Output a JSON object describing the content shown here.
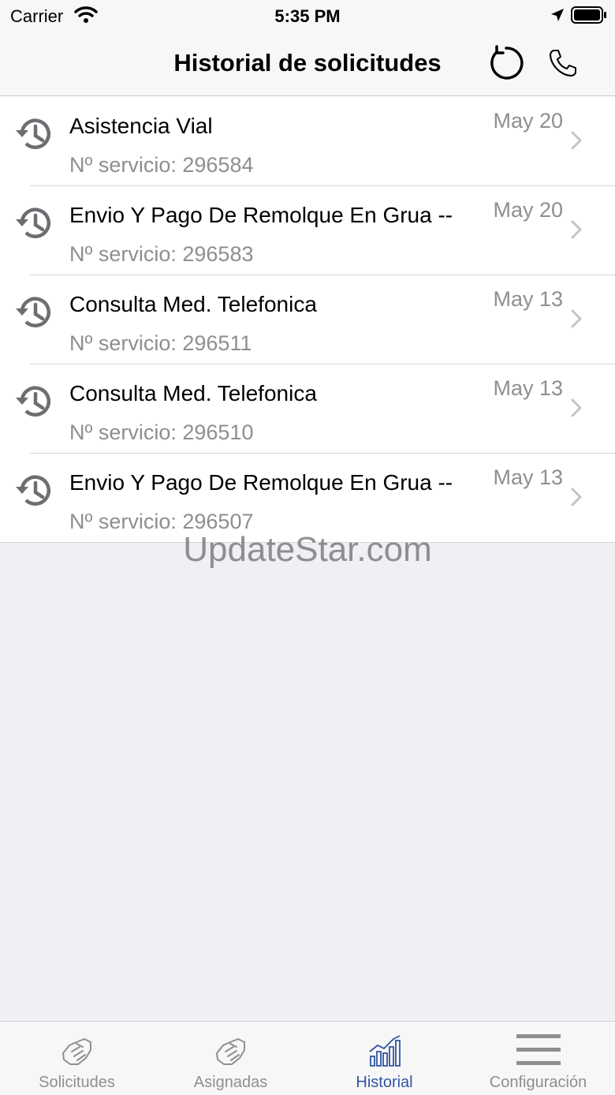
{
  "status_bar": {
    "carrier": "Carrier",
    "time": "5:35 PM"
  },
  "nav": {
    "title": "Historial de solicitudes",
    "refresh_icon": "refresh-icon",
    "phone_icon": "phone-icon"
  },
  "requests": [
    {
      "title": "Asistencia Vial",
      "service": "Nº servicio: 296584",
      "date": "May 20"
    },
    {
      "title": "Envio Y Pago De Remolque En Grua --",
      "service": "Nº servicio: 296583",
      "date": "May 20"
    },
    {
      "title": "Consulta Med. Telefonica",
      "service": "Nº servicio: 296511",
      "date": "May 13"
    },
    {
      "title": "Consulta Med. Telefonica",
      "service": "Nº servicio: 296510",
      "date": "May 13"
    },
    {
      "title": "Envio Y Pago De Remolque En Grua --",
      "service": "Nº servicio: 296507",
      "date": "May 13"
    }
  ],
  "watermark": "UpdateStar.com",
  "tabs": [
    {
      "label": "Solicitudes",
      "icon": "handshake-icon",
      "active": false
    },
    {
      "label": "Asignadas",
      "icon": "handshake-icon",
      "active": false
    },
    {
      "label": "Historial",
      "icon": "bar-chart-icon",
      "active": true
    },
    {
      "label": "Configuración",
      "icon": "menu-icon",
      "active": false
    }
  ],
  "colors": {
    "accent": "#2f55a4",
    "secondary_text": "#8e8e93",
    "background": "#efeff4"
  }
}
